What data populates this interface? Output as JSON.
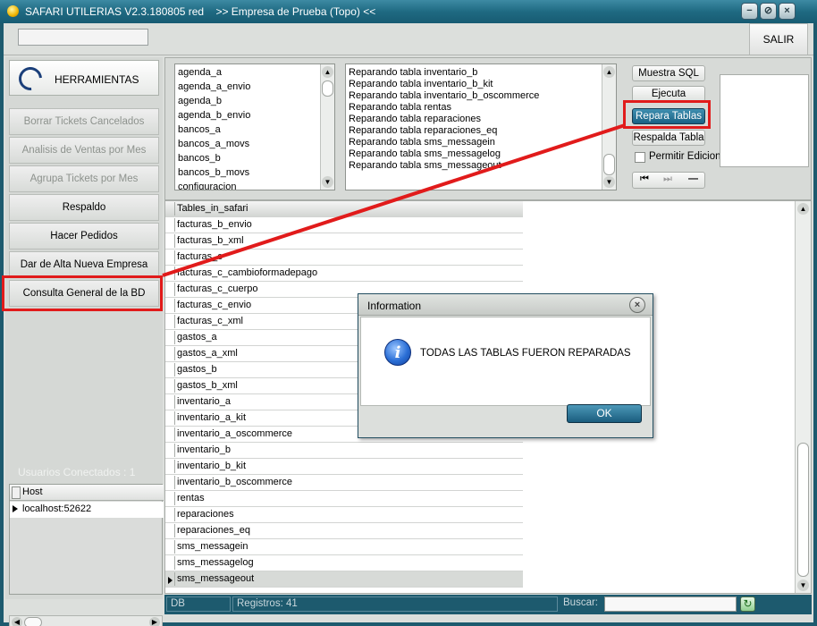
{
  "window": {
    "title": "SAFARI UTILERIAS V2.3.180805 red",
    "company": ">> Empresa de Prueba (Topo) <<",
    "buttons": [
      "minimize",
      "restore",
      "close"
    ]
  },
  "toolbar": {
    "search_value": "",
    "salir_label": "SALIR"
  },
  "sidebar": {
    "header_label": "HERRAMIENTAS",
    "items": [
      {
        "label": "Borrar Tickets Cancelados",
        "enabled": false
      },
      {
        "label": "Analisis de Ventas por Mes",
        "enabled": false
      },
      {
        "label": "Agrupa Tickets por Mes",
        "enabled": false
      },
      {
        "label": "Respaldo",
        "enabled": true
      },
      {
        "label": "Hacer Pedidos",
        "enabled": true
      },
      {
        "label": "Dar de Alta Nueva Empresa",
        "enabled": true
      },
      {
        "label": "Consulta General de la BD",
        "enabled": true
      }
    ],
    "users_label": "Usuarios Conectados : 1",
    "users_header": "Host",
    "users": [
      "localhost:52622"
    ]
  },
  "table_list": [
    "agenda_a",
    "agenda_a_envio",
    "agenda_b",
    "agenda_b_envio",
    "bancos_a",
    "bancos_a_movs",
    "bancos_b",
    "bancos_b_movs",
    "configuracion"
  ],
  "log_lines": [
    "Reparando tabla inventario_b",
    "Reparando tabla inventario_b_kit",
    "Reparando tabla inventario_b_oscommerce",
    "Reparando tabla rentas",
    "Reparando tabla reparaciones",
    "Reparando tabla reparaciones_eq",
    "Reparando tabla sms_messagein",
    "Reparando tabla sms_messagelog",
    "Reparando tabla sms_messageout"
  ],
  "actions": {
    "muestra_sql": "Muestra SQL",
    "ejecuta": "Ejecuta",
    "repara_tablas": "Repara Tablas",
    "respalda_tabla": "Respalda Tabla",
    "permitir_edicion": "Permitir Edicion"
  },
  "grid": {
    "header": "Tables_in_safari",
    "rows": [
      "facturas_b_envio",
      "facturas_b_xml",
      "facturas_c",
      "facturas_c_cambioformadepago",
      "facturas_c_cuerpo",
      "facturas_c_envio",
      "facturas_c_xml",
      "gastos_a",
      "gastos_a_xml",
      "gastos_b",
      "gastos_b_xml",
      "inventario_a",
      "inventario_a_kit",
      "inventario_a_oscommerce",
      "inventario_b",
      "inventario_b_kit",
      "inventario_b_oscommerce",
      "rentas",
      "reparaciones",
      "reparaciones_eq",
      "sms_messagein",
      "sms_messagelog",
      "sms_messageout"
    ],
    "selected_index": 22
  },
  "statusbar": {
    "db": "DB",
    "registros": "Registros: 41",
    "buscar": "Buscar:"
  },
  "dialog": {
    "title": "Information",
    "message": "TODAS LAS TABLAS FUERON REPARADAS",
    "ok_label": "OK"
  },
  "colors": {
    "annotation_red": "#e11b1b",
    "title_blue": "#1f6a82",
    "active_button": "#1b6285"
  }
}
